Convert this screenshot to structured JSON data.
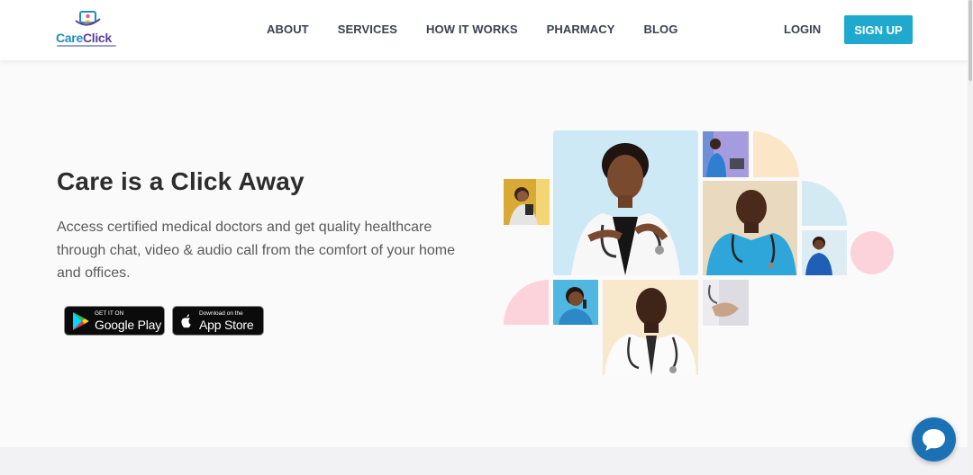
{
  "brand": {
    "name_part1": "Care",
    "name_part2": "Click",
    "colors": {
      "primary": "#1fa9cf",
      "purple": "#5b3fa0",
      "chat": "#1a72b5"
    }
  },
  "nav": {
    "links": [
      "ABOUT",
      "SERVICES",
      "HOW IT WORKS",
      "PHARMACY",
      "BLOG"
    ],
    "login": "LOGIN",
    "signup": "SIGN UP"
  },
  "hero": {
    "title": "Care is a Click Away",
    "description": "Access certified medical doctors and get quality healthcare through chat, video & audio call from the comfort of your home and offices."
  },
  "stores": {
    "google": {
      "small": "GET IT ON",
      "big": "Google Play",
      "icon": "google-play-icon"
    },
    "apple": {
      "small": "Download on the",
      "big": "App Store",
      "icon": "apple-icon"
    }
  },
  "chat": {
    "icon": "chat-bubble-icon"
  }
}
